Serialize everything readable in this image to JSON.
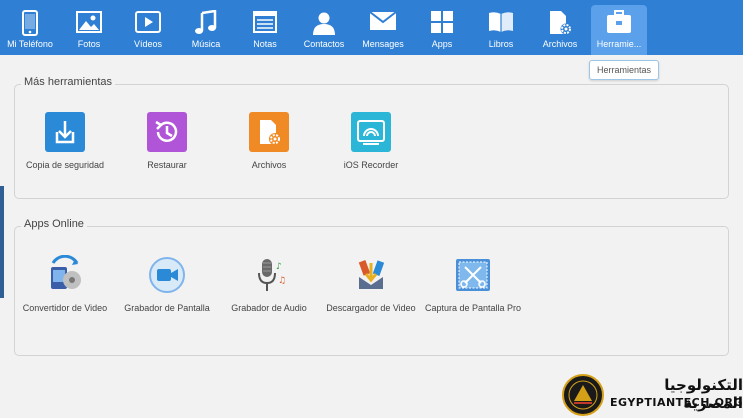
{
  "nav": {
    "items": [
      {
        "label": "Mi Teléfono",
        "icon": "phone-icon"
      },
      {
        "label": "Fotos",
        "icon": "photos-icon"
      },
      {
        "label": "Vídeos",
        "icon": "video-icon"
      },
      {
        "label": "Música",
        "icon": "music-icon"
      },
      {
        "label": "Notas",
        "icon": "notes-icon"
      },
      {
        "label": "Contactos",
        "icon": "contacts-icon"
      },
      {
        "label": "Mensages",
        "icon": "envelope-icon"
      },
      {
        "label": "Apps",
        "icon": "apps-grid-icon"
      },
      {
        "label": "Libros",
        "icon": "book-icon"
      },
      {
        "label": "Archivos",
        "icon": "file-gear-icon"
      },
      {
        "label": "Herramie...",
        "icon": "toolbox-icon"
      }
    ],
    "active_index": 10
  },
  "tooltip": {
    "text": "Herramientas"
  },
  "tools_panel": {
    "title": "Más herramientas",
    "items": [
      {
        "label": "Copia de seguridad",
        "icon": "backup-icon",
        "color": "#2a8ad8"
      },
      {
        "label": "Restaurar",
        "icon": "restore-icon",
        "color": "#b055d8"
      },
      {
        "label": "Archivos",
        "icon": "files-icon",
        "color": "#f08a24"
      },
      {
        "label": "iOS Recorder",
        "icon": "ios-recorder-icon",
        "color": "#2bb5d6"
      }
    ]
  },
  "online_panel": {
    "title": "Apps Online",
    "items": [
      {
        "label": "Convertidor de Video",
        "icon": "video-converter-icon"
      },
      {
        "label": "Grabador de Pantalla",
        "icon": "screen-recorder-icon"
      },
      {
        "label": "Grabador de Audio",
        "icon": "audio-recorder-icon"
      },
      {
        "label": "Descargador de Video",
        "icon": "video-downloader-icon"
      },
      {
        "label": "Captura de Pantalla Pro",
        "icon": "screenshot-pro-icon"
      }
    ]
  },
  "watermark": {
    "arabic": "التكنولوجيا المصرية",
    "latin": "EGYPTIANTECH.ORG"
  }
}
